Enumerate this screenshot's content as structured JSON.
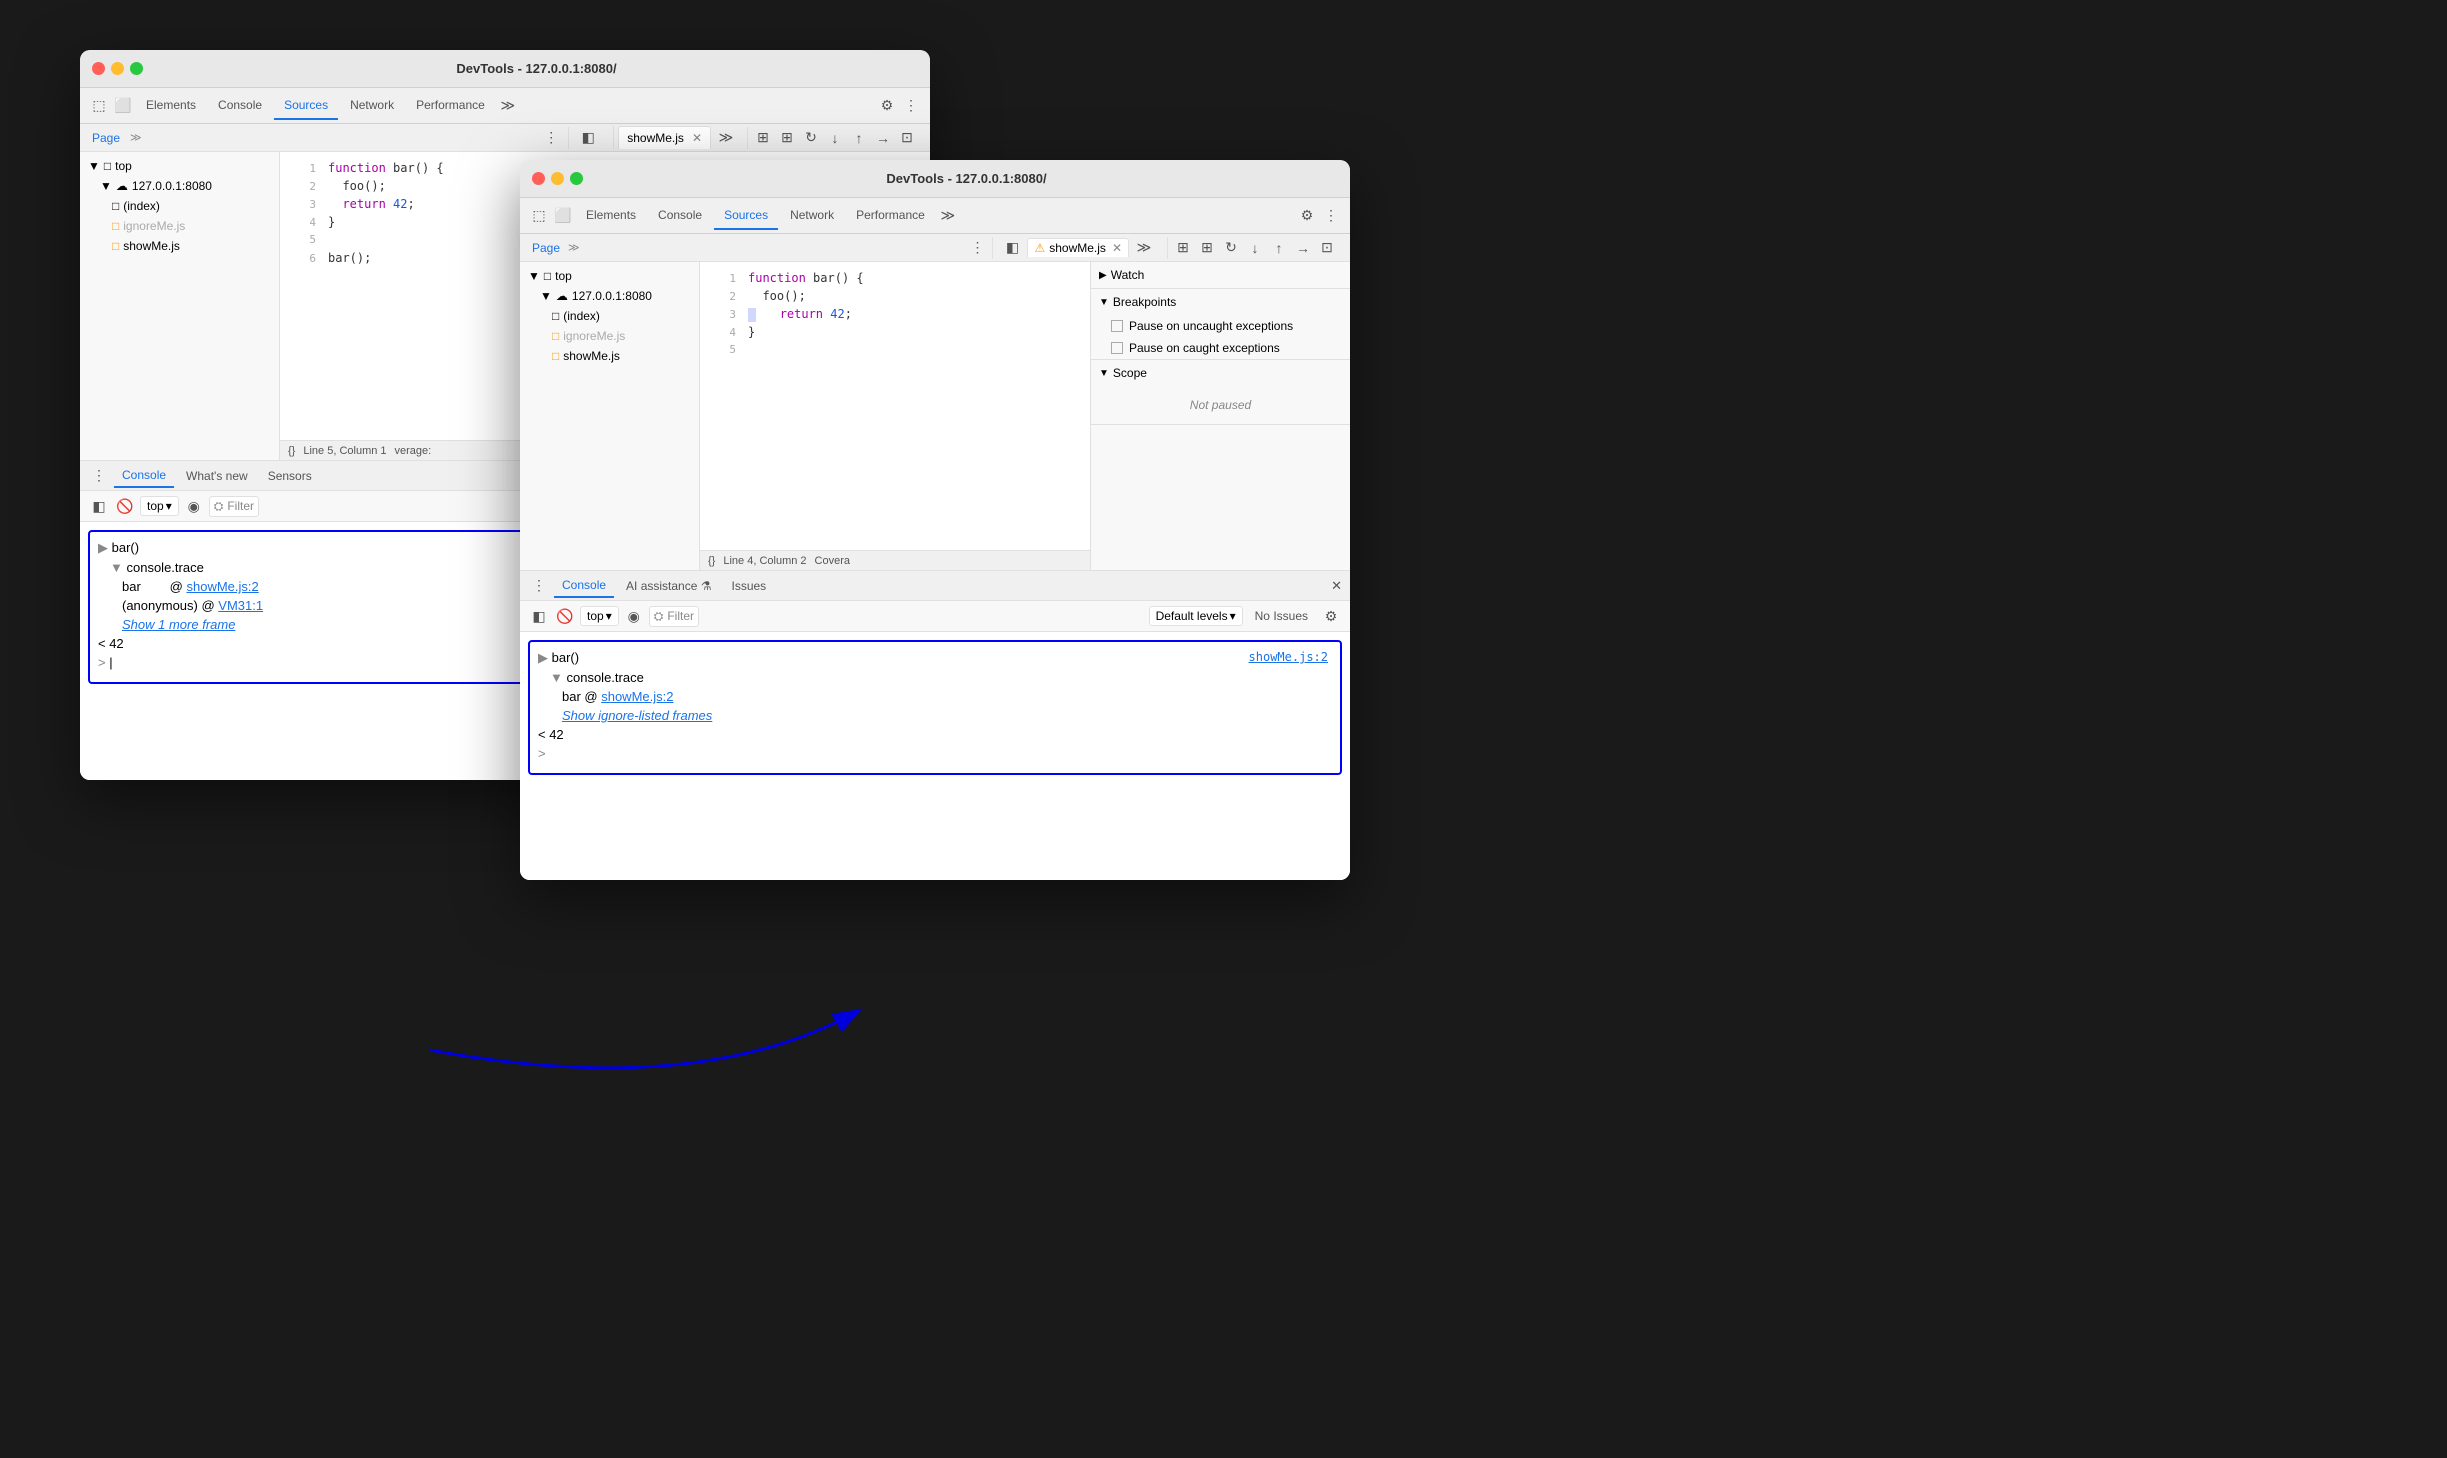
{
  "bg_window": {
    "title": "DevTools - 127.0.0.1:8080/",
    "tabs": [
      "Elements",
      "Console",
      "Sources",
      "Network",
      "Performance"
    ],
    "active_tab": "Sources",
    "file_panel": {
      "tab": "Page",
      "tree": [
        {
          "indent": 0,
          "icon": "triangle",
          "label": "top",
          "type": "folder"
        },
        {
          "indent": 1,
          "icon": "cloud",
          "label": "127.0.0.1:8080",
          "type": "server"
        },
        {
          "indent": 2,
          "icon": "page",
          "label": "(index)",
          "type": "file"
        },
        {
          "indent": 2,
          "icon": "js-warn",
          "label": "ignoreMe.js",
          "type": "js"
        },
        {
          "indent": 2,
          "icon": "js",
          "label": "showMe.js",
          "type": "js"
        }
      ]
    },
    "code": {
      "file": "showMe.js",
      "lines": [
        {
          "num": 1,
          "content": "function bar() {"
        },
        {
          "num": 2,
          "content": "  foo();"
        },
        {
          "num": 3,
          "content": "  return 42;"
        },
        {
          "num": 4,
          "content": "}"
        },
        {
          "num": 5,
          "content": ""
        },
        {
          "num": 6,
          "content": "bar();"
        }
      ]
    },
    "status": "Line 5, Column 1",
    "status_right": "verage:",
    "console": {
      "tabs": [
        "Console",
        "What's new",
        "Sensors"
      ],
      "active_tab": "Console",
      "filter_label": "Filter",
      "top_label": "top",
      "entries": [
        {
          "type": "expand",
          "text": "bar()"
        },
        {
          "type": "trace_header",
          "text": "console.trace"
        },
        {
          "type": "trace_item",
          "label": "bar",
          "link": "showMe.js:2"
        },
        {
          "type": "trace_item",
          "label": "(anonymous)",
          "link": "VM31:1"
        },
        {
          "type": "show_more",
          "text": "Show 1 more frame"
        },
        {
          "type": "value",
          "text": "< 42"
        },
        {
          "type": "input",
          "text": ">"
        }
      ]
    }
  },
  "fg_window": {
    "title": "DevTools - 127.0.0.1:8080/",
    "tabs": [
      "Elements",
      "Console",
      "Sources",
      "Network",
      "Performance"
    ],
    "active_tab": "Sources",
    "file_panel": {
      "tab": "Page",
      "tree": [
        {
          "indent": 0,
          "icon": "triangle",
          "label": "top",
          "type": "folder"
        },
        {
          "indent": 1,
          "icon": "cloud",
          "label": "127.0.0.1:8080",
          "type": "server"
        },
        {
          "indent": 2,
          "icon": "page",
          "label": "(index)",
          "type": "file"
        },
        {
          "indent": 2,
          "icon": "js-warn",
          "label": "ignoreMe.js",
          "type": "js"
        },
        {
          "indent": 2,
          "icon": "js",
          "label": "showMe.js",
          "type": "js"
        }
      ]
    },
    "code": {
      "file": "showMe.js",
      "file_warn": true,
      "lines": [
        {
          "num": 1,
          "content": "function bar() {"
        },
        {
          "num": 2,
          "content": "  foo();"
        },
        {
          "num": 3,
          "content": "  return 42;"
        },
        {
          "num": 4,
          "content": "}"
        },
        {
          "num": 5,
          "content": ""
        }
      ]
    },
    "status": "Line 4, Column 2",
    "status_right": "Covera",
    "console": {
      "tabs": [
        "Console",
        "AI assistance",
        "Issues"
      ],
      "active_tab": "Console",
      "filter_label": "Filter",
      "top_label": "top",
      "levels_label": "Default levels",
      "no_issues": "No Issues",
      "entries": [
        {
          "type": "expand",
          "text": "bar()"
        },
        {
          "type": "trace_header",
          "text": "console.trace"
        },
        {
          "type": "trace_item",
          "label": "bar @",
          "link": "showMe.js:2"
        },
        {
          "type": "show_more",
          "text": "Show ignore-listed frames"
        },
        {
          "type": "value",
          "text": "< 42"
        },
        {
          "type": "input",
          "text": ">"
        }
      ],
      "link_right": "showMe.js:2"
    },
    "debugger": {
      "sections": [
        {
          "label": "Watch",
          "collapsed": true
        },
        {
          "label": "Breakpoints",
          "collapsed": false
        },
        {
          "label": "Scope",
          "collapsed": false
        }
      ],
      "breakpoints": [
        {
          "label": "Pause on uncaught exceptions"
        },
        {
          "label": "Pause on caught exceptions"
        }
      ],
      "scope_status": "Not paused"
    }
  },
  "icons": {
    "close": "✕",
    "triangle_right": "▶",
    "triangle_down": "▼",
    "chevron_down": "▾",
    "gear": "⚙",
    "more_vert": "⋮",
    "more_horiz": "≫",
    "eye": "◉",
    "filter": "⛭",
    "warn": "⚠",
    "cloud": "☁",
    "page": "□",
    "inspector": "⬚",
    "device": "⬜",
    "break": "⏸",
    "clear": "🚫"
  }
}
